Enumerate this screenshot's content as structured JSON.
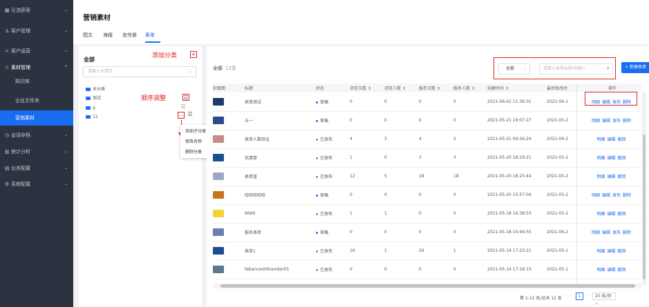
{
  "sidebar": {
    "items": [
      {
        "icon": "grid-icon",
        "glyph": "▦",
        "label": "引流获客"
      },
      {
        "icon": "users-icon",
        "glyph": "♙",
        "label": "客户管理"
      },
      {
        "icon": "share-icon",
        "glyph": "<",
        "label": "客户运营"
      },
      {
        "icon": "star-icon",
        "glyph": "☆",
        "label": "素材管理"
      },
      {
        "icon": "chat-icon",
        "glyph": "◷",
        "label": "会话存档"
      },
      {
        "icon": "chart-icon",
        "glyph": "▥",
        "label": "统计分析"
      },
      {
        "icon": "table-icon",
        "glyph": "▤",
        "label": "业务配置"
      },
      {
        "icon": "gear-icon",
        "glyph": "⚙",
        "label": "系统配置"
      }
    ],
    "sub_items": [
      "知识库",
      "企业文件夹",
      "营销素材"
    ]
  },
  "header": {
    "title": "营销素材",
    "tabs": [
      "图文",
      "海报",
      "宣传册",
      "表单"
    ]
  },
  "left_panel": {
    "title": "全部",
    "search_placeholder": "请输入关键字",
    "tree": [
      "未分类",
      "测试",
      "q",
      "12"
    ],
    "context_menu": [
      "添加子分类",
      "修改名称",
      "删除分类"
    ]
  },
  "annotations": {
    "add_category": "添加分类",
    "sort_adjust": "顺序调整"
  },
  "main": {
    "all_label": "全部",
    "count": "12条",
    "filter_select": "全部",
    "search_placeholder": "请输入表单标题/创建人",
    "new_button": "+ 新建表单",
    "columns": [
      "封面图",
      "标题",
      "状态",
      "浏览次数",
      "浏览人数",
      "报名次数",
      "报名人数",
      "创建时间",
      "最后修改时",
      "操作"
    ],
    "sort_glyph": "⇕",
    "rows": [
      {
        "thumb": "#1e3a6e",
        "title": "表单测试",
        "status": "草稿",
        "views": "0",
        "viewers": "0",
        "signups": "0",
        "signers": "0",
        "created": "2021-06-02 11:36:01",
        "modified": "2021-06-1",
        "ops": [
          "明细",
          "编辑",
          "发布",
          "删除"
        ]
      },
      {
        "thumb": "#2d4a8a",
        "title": "五一",
        "status": "草稿",
        "views": "0",
        "viewers": "0",
        "signups": "0",
        "signers": "0",
        "created": "2021-05-21 19:07:27",
        "modified": "2021-05-2",
        "ops": [
          "明细",
          "编辑",
          "发布",
          "删除"
        ]
      },
      {
        "thumb": "#c98a8a",
        "title": "表单人数验证",
        "status": "已发布",
        "views": "4",
        "viewers": "3",
        "signups": "4",
        "signers": "2",
        "created": "2021-05-21 09:26:24",
        "modified": "2021-06-2",
        "ops": [
          "明细",
          "编辑",
          "撤回"
        ]
      },
      {
        "thumb": "#1b4f8f",
        "title": "优惠卷",
        "status": "已发布",
        "views": "1",
        "viewers": "0",
        "signups": "3",
        "signers": "3",
        "created": "2021-05-20 18:29:21",
        "modified": "2021-05-2",
        "ops": [
          "明细",
          "编辑",
          "撤回"
        ]
      },
      {
        "thumb": "#9fa8c0",
        "title": "表单蓝",
        "status": "已发布",
        "views": "12",
        "viewers": "5",
        "signups": "18",
        "signers": "18",
        "created": "2021-05-20 18:25:44",
        "modified": "2021-05-2",
        "ops": [
          "明细",
          "编辑",
          "撤回"
        ]
      },
      {
        "thumb": "#c8741e",
        "title": "哈哈哈哈哈",
        "status": "草稿",
        "views": "0",
        "viewers": "0",
        "signups": "0",
        "signers": "0",
        "created": "2021-05-20 15:57:04",
        "modified": "2021-05-2",
        "ops": [
          "明细",
          "编辑",
          "发布",
          "删除"
        ]
      },
      {
        "thumb": "#f2d23a",
        "title": "6666",
        "status": "已发布",
        "views": "1",
        "viewers": "1",
        "signups": "0",
        "signers": "0",
        "created": "2021-05-18 16:38:53",
        "modified": "2021-05-2",
        "ops": [
          "明细",
          "编辑",
          "撤回"
        ]
      },
      {
        "thumb": "#6a7fb0",
        "title": "报名表单",
        "status": "草稿",
        "views": "0",
        "viewers": "0",
        "signups": "0",
        "signers": "0",
        "created": "2021-05-18 10:46:55",
        "modified": "2021-06-2",
        "ops": [
          "明细",
          "编辑",
          "发布",
          "删除"
        ]
      },
      {
        "thumb": "#1e4e8c",
        "title": "表单1",
        "status": "已发布",
        "views": "16",
        "viewers": "1",
        "signups": "29",
        "signers": "1",
        "created": "2021-05-14 17:23:21",
        "modified": "2021-05-1",
        "ops": [
          "明细",
          "编辑",
          "撤回"
        ]
      },
      {
        "thumb": "#5a7a8a",
        "title": "fabanceshibiaodan01",
        "status": "已发布",
        "views": "0",
        "viewers": "0",
        "signups": "0",
        "signers": "0",
        "created": "2021-05-14 17:18:13",
        "modified": "2021-05-1",
        "ops": [
          "明细",
          "编辑",
          "撤回"
        ]
      }
    ]
  },
  "pagination": {
    "summary": "第 1-12 条/总共 12 条",
    "page": "1",
    "page_size": "20 条/页",
    "prev_glyph": "‹",
    "next_glyph": "›",
    "chevron": "⌄"
  },
  "colors": {
    "draft": "#1a6cf0",
    "published": "#2ec15a",
    "accent": "#1a6cf0",
    "annotation": "#e02020"
  }
}
